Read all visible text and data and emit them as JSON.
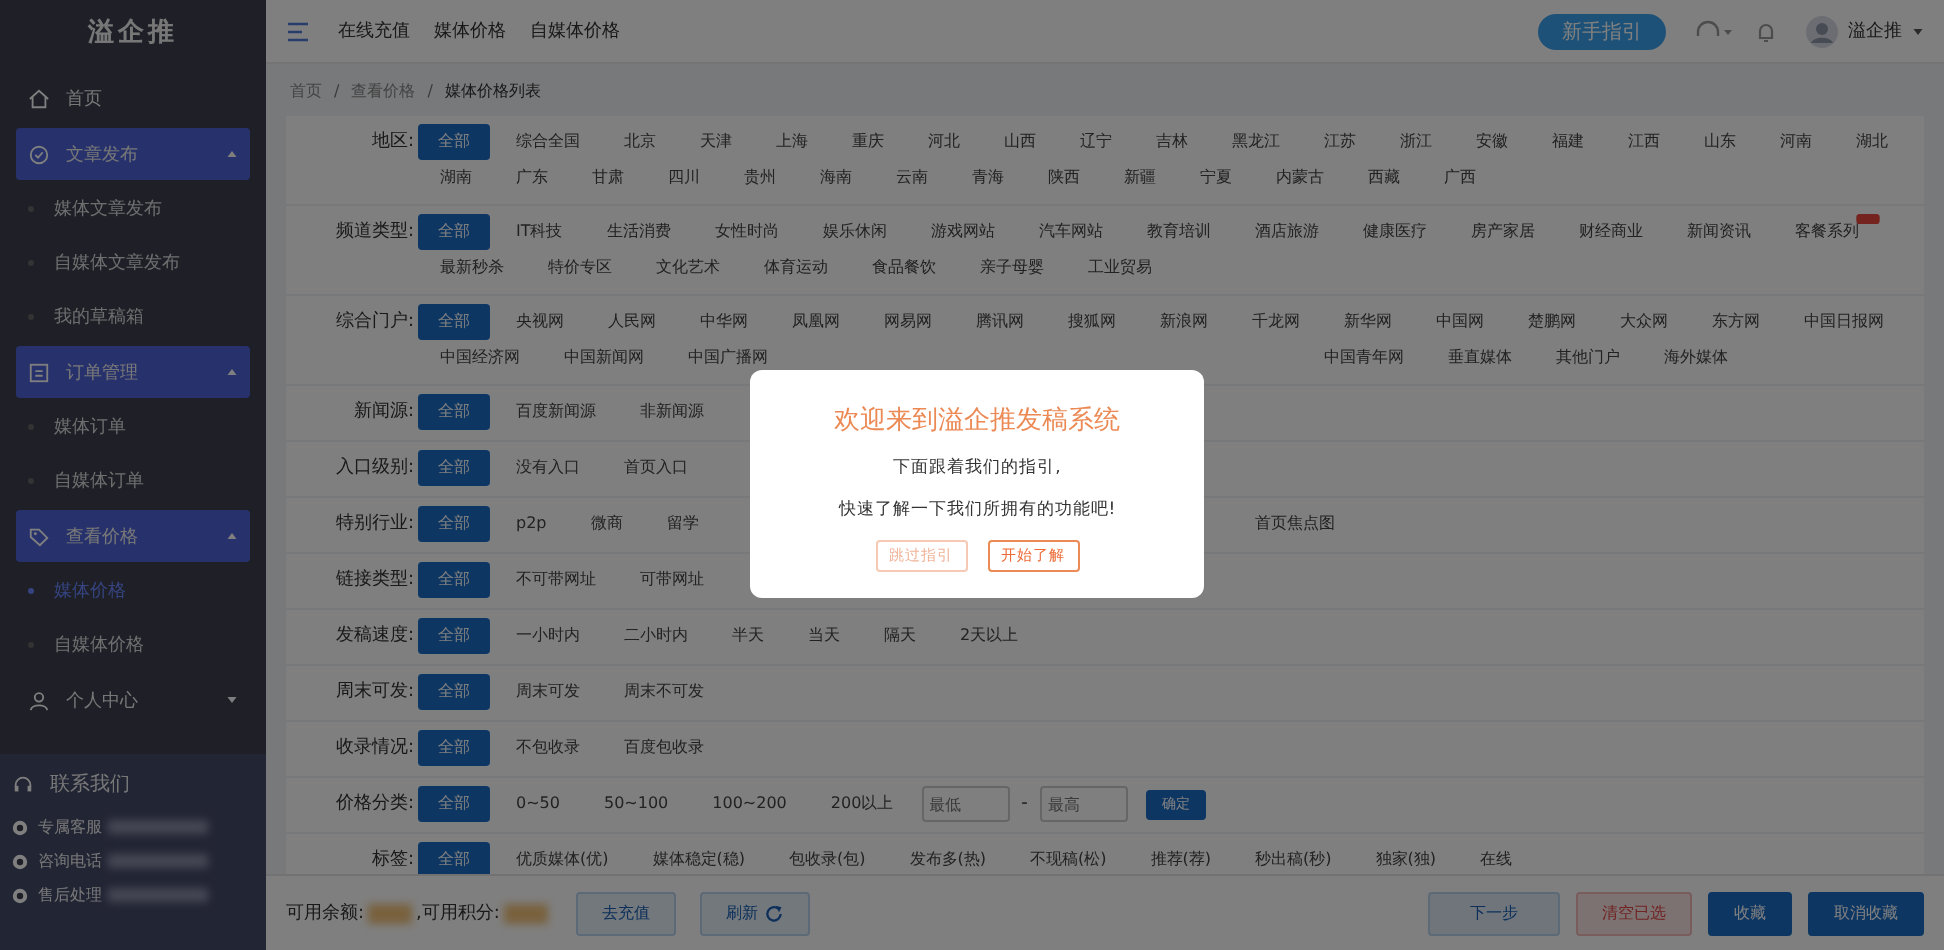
{
  "sidebar": {
    "logo": "溢企推",
    "items": [
      {
        "kind": "link",
        "label": "首页"
      },
      {
        "kind": "group",
        "label": "文章发布",
        "expanded": true,
        "children": [
          {
            "label": "媒体文章发布",
            "selected": false
          },
          {
            "label": "自媒体文章发布",
            "selected": false
          },
          {
            "label": "我的草稿箱",
            "selected": false
          }
        ]
      },
      {
        "kind": "group",
        "label": "订单管理",
        "expanded": true,
        "children": [
          {
            "label": "媒体订单",
            "selected": false
          },
          {
            "label": "自媒体订单",
            "selected": false
          }
        ]
      },
      {
        "kind": "group",
        "label": "查看价格",
        "expanded": true,
        "children": [
          {
            "label": "媒体价格",
            "selected": true
          },
          {
            "label": "自媒体价格",
            "selected": false
          }
        ]
      },
      {
        "kind": "group",
        "label": "个人中心",
        "expanded": false
      }
    ],
    "contact": {
      "title": "联系我们",
      "rows": [
        "专属客服",
        "咨询电话",
        "售后处理"
      ]
    }
  },
  "topbar": {
    "links": [
      "在线充值",
      "媒体价格",
      "自媒体价格"
    ],
    "guide_button": "新手指引",
    "user": "溢企推"
  },
  "breadcrumb": [
    "首页",
    "查看价格",
    "媒体价格列表"
  ],
  "breadcrumb_separator": "/",
  "filters": [
    {
      "label": "地区:",
      "options": [
        {
          "text": "全部",
          "selected": true
        },
        {
          "text": "综合全国",
          "selected": false
        },
        {
          "text": "北京",
          "selected": false
        },
        {
          "text": "天津",
          "selected": false
        },
        {
          "text": "上海",
          "selected": false
        },
        {
          "text": "重庆",
          "selected": false
        },
        {
          "text": "河北",
          "selected": false
        },
        {
          "text": "山西",
          "selected": false
        },
        {
          "text": "辽宁",
          "selected": false
        },
        {
          "text": "吉林",
          "selected": false
        },
        {
          "text": "黑龙江",
          "selected": false
        },
        {
          "text": "江苏",
          "selected": false
        },
        {
          "text": "浙江",
          "selected": false
        },
        {
          "text": "安徽",
          "selected": false
        },
        {
          "text": "福建",
          "selected": false
        },
        {
          "text": "江西",
          "selected": false
        },
        {
          "text": "山东",
          "selected": false
        },
        {
          "text": "河南",
          "selected": false
        },
        {
          "text": "湖北",
          "selected": false
        },
        {
          "text": "湖南",
          "selected": false
        },
        {
          "text": "广东",
          "selected": false
        },
        {
          "text": "甘肃",
          "selected": false
        },
        {
          "text": "四川",
          "selected": false
        },
        {
          "text": "贵州",
          "selected": false
        },
        {
          "text": "海南",
          "selected": false
        },
        {
          "text": "云南",
          "selected": false
        },
        {
          "text": "青海",
          "selected": false
        },
        {
          "text": "陕西",
          "selected": false
        },
        {
          "text": "新疆",
          "selected": false
        },
        {
          "text": "宁夏",
          "selected": false
        },
        {
          "text": "内蒙古",
          "selected": false
        },
        {
          "text": "西藏",
          "selected": false
        },
        {
          "text": "广西",
          "selected": false
        }
      ]
    },
    {
      "label": "频道类型:",
      "options": [
        {
          "text": "全部",
          "selected": true
        },
        {
          "text": "IT科技",
          "selected": false
        },
        {
          "text": "生活消费",
          "selected": false
        },
        {
          "text": "女性时尚",
          "selected": false
        },
        {
          "text": "娱乐休闲",
          "selected": false
        },
        {
          "text": "游戏网站",
          "selected": false
        },
        {
          "text": "汽车网站",
          "selected": false
        },
        {
          "text": "教育培训",
          "selected": false
        },
        {
          "text": "酒店旅游",
          "selected": false
        },
        {
          "text": "健康医疗",
          "selected": false
        },
        {
          "text": "房产家居",
          "selected": false
        },
        {
          "text": "财经商业",
          "selected": false
        },
        {
          "text": "新闻资讯",
          "selected": false
        },
        {
          "text": "客餐系列",
          "selected": false,
          "hot": true
        },
        {
          "text": "最新秒杀",
          "selected": false
        },
        {
          "text": "特价专区",
          "selected": false
        },
        {
          "text": "文化艺术",
          "selected": false
        },
        {
          "text": "体育运动",
          "selected": false
        },
        {
          "text": "食品餐饮",
          "selected": false
        },
        {
          "text": "亲子母婴",
          "selected": false
        },
        {
          "text": "工业贸易",
          "selected": false
        }
      ]
    },
    {
      "label": "综合门户:",
      "options": [
        {
          "text": "全部",
          "selected": true
        },
        {
          "text": "央视网",
          "selected": false
        },
        {
          "text": "人民网",
          "selected": false
        },
        {
          "text": "中华网",
          "selected": false
        },
        {
          "text": "凤凰网",
          "selected": false
        },
        {
          "text": "网易网",
          "selected": false
        },
        {
          "text": "腾讯网",
          "selected": false
        },
        {
          "text": "搜狐网",
          "selected": false
        },
        {
          "text": "新浪网",
          "selected": false
        },
        {
          "text": "千龙网",
          "selected": false
        },
        {
          "text": "新华网",
          "selected": false
        },
        {
          "text": "中国网",
          "selected": false
        },
        {
          "text": "楚鹏网",
          "selected": false
        },
        {
          "text": "大众网",
          "selected": false
        },
        {
          "text": "东方网",
          "selected": false
        },
        {
          "text": "中国日报网",
          "selected": false
        },
        {
          "text": "中国经济网",
          "selected": false
        },
        {
          "text": "中国新闻网",
          "selected": false
        },
        {
          "text": "中国广播网",
          "selected": false
        }
      ],
      "options_after_gap": [
        {
          "text": "中国青年网",
          "selected": false
        },
        {
          "text": "垂直媒体",
          "selected": false
        },
        {
          "text": "其他门户",
          "selected": false
        },
        {
          "text": "海外媒体",
          "selected": false
        }
      ]
    },
    {
      "label": "新闻源:",
      "options": [
        {
          "text": "全部",
          "selected": true
        },
        {
          "text": "百度新闻源",
          "selected": false
        },
        {
          "text": "非新闻源",
          "selected": false
        }
      ]
    },
    {
      "label": "入口级别:",
      "options": [
        {
          "text": "全部",
          "selected": true
        },
        {
          "text": "没有入口",
          "selected": false
        },
        {
          "text": "首页入口",
          "selected": false
        }
      ]
    },
    {
      "label": "特别行业:",
      "options": [
        {
          "text": "全部",
          "selected": true
        },
        {
          "text": "p2p",
          "selected": false
        },
        {
          "text": "微商",
          "selected": false
        },
        {
          "text": "留学",
          "selected": false
        }
      ],
      "options_after_gap": [
        {
          "text": "首页焦点图",
          "selected": false
        }
      ]
    },
    {
      "label": "链接类型:",
      "options": [
        {
          "text": "全部",
          "selected": true
        },
        {
          "text": "不可带网址",
          "selected": false
        },
        {
          "text": "可带网址",
          "selected": false
        }
      ]
    },
    {
      "label": "发稿速度:",
      "options": [
        {
          "text": "全部",
          "selected": true
        },
        {
          "text": "一小时内",
          "selected": false
        },
        {
          "text": "二小时内",
          "selected": false
        },
        {
          "text": "半天",
          "selected": false
        },
        {
          "text": "当天",
          "selected": false
        },
        {
          "text": "隔天",
          "selected": false
        },
        {
          "text": "2天以上",
          "selected": false
        }
      ]
    },
    {
      "label": "周末可发:",
      "options": [
        {
          "text": "全部",
          "selected": true
        },
        {
          "text": "周末可发",
          "selected": false
        },
        {
          "text": "周末不可发",
          "selected": false
        }
      ]
    },
    {
      "label": "收录情况:",
      "options": [
        {
          "text": "全部",
          "selected": true
        },
        {
          "text": "不包收录",
          "selected": false
        },
        {
          "text": "百度包收录",
          "selected": false
        }
      ]
    },
    {
      "label": "价格分类:",
      "options": [
        {
          "text": "全部",
          "selected": true
        },
        {
          "text": "0~50",
          "selected": false
        },
        {
          "text": "50~100",
          "selected": false
        },
        {
          "text": "100~200",
          "selected": false
        },
        {
          "text": "200以上",
          "selected": false
        }
      ],
      "price_range": {
        "min_placeholder": "最低",
        "separator": "-",
        "max_placeholder": "最高",
        "button": "确定"
      }
    },
    {
      "label": "标签:",
      "options": [
        {
          "text": "全部",
          "selected": true
        },
        {
          "text": "优质媒体(优)",
          "selected": false
        },
        {
          "text": "媒体稳定(稳)",
          "selected": false
        },
        {
          "text": "包收录(包)",
          "selected": false
        },
        {
          "text": "发布多(热)",
          "selected": false
        },
        {
          "text": "不现稿(松)",
          "selected": false
        },
        {
          "text": "推荐(荐)",
          "selected": false
        },
        {
          "text": "秒出稿(秒)",
          "selected": false
        },
        {
          "text": "独家(独)",
          "selected": false
        },
        {
          "text": "在线",
          "selected": false
        }
      ]
    }
  ],
  "bottom_bar": {
    "balance_label": "可用余额:",
    "points_label": ",可用积分:",
    "recharge": "去充值",
    "refresh": "刷新",
    "buttons": [
      {
        "text": "下一步",
        "kind": "light"
      },
      {
        "text": "清空已选",
        "kind": "danger"
      },
      {
        "text": "收藏",
        "kind": "primary"
      },
      {
        "text": "取消收藏",
        "kind": "primary"
      }
    ]
  },
  "modal": {
    "title": "欢迎来到溢企推发稿系统",
    "lines": [
      "下面跟着我们的指引,",
      "快速了解一下我们所拥有的功能吧!"
    ],
    "skip": "跳过指引",
    "start": "开始了解"
  }
}
